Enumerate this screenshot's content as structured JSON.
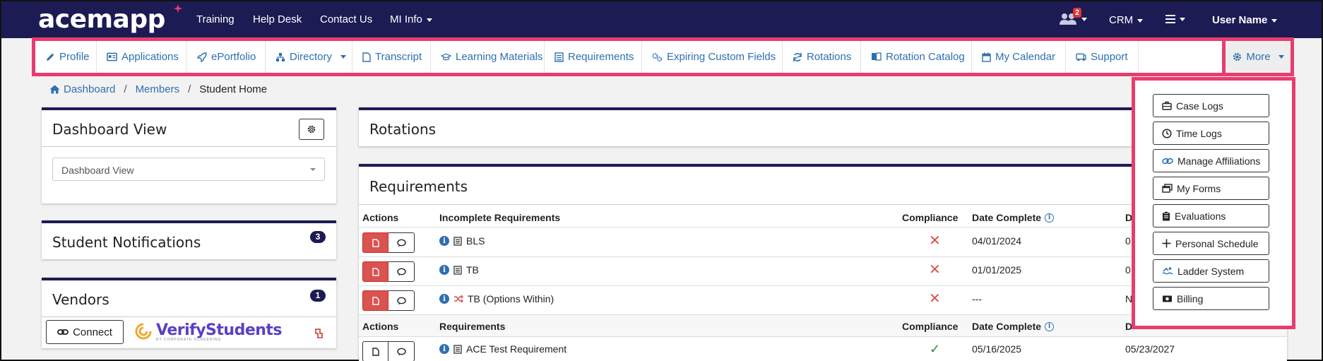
{
  "brand": {
    "logo_text": "acemapp"
  },
  "topnav": {
    "links": [
      "Training",
      "Help Desk",
      "Contact Us",
      "MI Info"
    ],
    "notification_count": "2",
    "crm_label": "CRM",
    "user_name": "User Name"
  },
  "subnav": {
    "items": [
      {
        "label": "Profile",
        "icon": "pencil-icon"
      },
      {
        "label": "Applications",
        "icon": "id-card-icon"
      },
      {
        "label": "ePortfolio",
        "icon": "rocket-icon"
      },
      {
        "label": "Directory",
        "icon": "sitemap-icon"
      },
      {
        "label": "Transcript",
        "icon": "file-icon"
      },
      {
        "label": "Learning Materials",
        "icon": "graduation-cap-icon"
      },
      {
        "label": "Requirements",
        "icon": "list-icon"
      },
      {
        "label": "Expiring Custom Fields",
        "icon": "gears-icon"
      },
      {
        "label": "Rotations",
        "icon": "refresh-icon"
      },
      {
        "label": "Rotation Catalog",
        "icon": "book-icon"
      },
      {
        "label": "My Calendar",
        "icon": "calendar-icon"
      },
      {
        "label": "Support",
        "icon": "support-icon"
      }
    ],
    "more_label": "More"
  },
  "breadcrumb": {
    "items": [
      "Dashboard",
      "Members",
      "Student Home"
    ]
  },
  "dashboard_view": {
    "title": "Dashboard View",
    "select_value": "Dashboard View"
  },
  "student_notifications": {
    "title": "Student Notifications",
    "count": "3"
  },
  "vendors": {
    "title": "Vendors",
    "count": "1",
    "connect_label": "Connect",
    "vendor_name": "VerifyStudents",
    "vendor_tagline": "BY CORPORATE SCREENING"
  },
  "rotations": {
    "title": "Rotations"
  },
  "requirements": {
    "title": "Requirements",
    "incomplete_headers": [
      "Actions",
      "Incomplete Requirements",
      "Compliance",
      "Date Complete",
      "D"
    ],
    "incomplete_rows": [
      {
        "name": "BLS",
        "date_complete": "04/01/2024",
        "extra": "0"
      },
      {
        "name": "TB",
        "date_complete": "01/01/2025",
        "extra": "0"
      },
      {
        "name": "TB (Options Within)",
        "date_complete": "---",
        "extra": "N"
      }
    ],
    "complete_headers": [
      "Actions",
      "Requirements",
      "Compliance",
      "Date Complete",
      "D"
    ],
    "complete_rows": [
      {
        "name": "ACE Test Requirement",
        "date_complete": "05/16/2025",
        "extra": "05/23/2027"
      }
    ]
  },
  "more_menu": {
    "items": [
      {
        "label": "Case Logs",
        "icon": "briefcase-icon"
      },
      {
        "label": "Time Logs",
        "icon": "clock-icon"
      },
      {
        "label": "Manage Affiliations",
        "icon": "link-icon"
      },
      {
        "label": "My Forms",
        "icon": "windows-icon"
      },
      {
        "label": "Evaluations",
        "icon": "clipboard-icon"
      },
      {
        "label": "Personal Schedule",
        "icon": "plus-icon"
      },
      {
        "label": "Ladder System",
        "icon": "swimmer-icon"
      },
      {
        "label": "Billing",
        "icon": "money-icon"
      }
    ]
  },
  "colors": {
    "navy": "#1d1b54",
    "highlight": "#e83c6f",
    "link": "#2f6fb0",
    "danger": "#d9534f",
    "success": "#2e8b3e"
  }
}
